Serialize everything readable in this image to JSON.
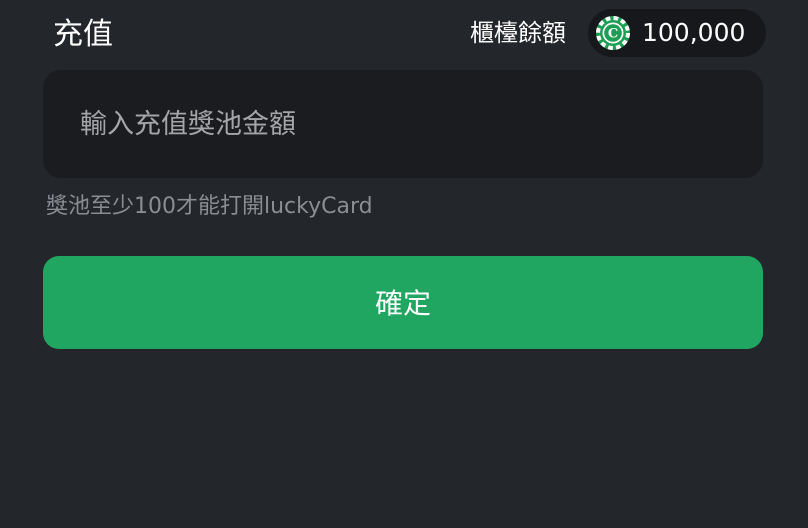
{
  "header": {
    "title": "充值",
    "balance_label": "櫃檯餘額",
    "balance_value": "100,000",
    "coin_icon": "chip-c-icon",
    "coin_letter": "C",
    "coin_color": "#1e9e55"
  },
  "form": {
    "amount_placeholder": "輸入充值獎池金額",
    "amount_value": "",
    "hint": "獎池至少100才能打開luckyCard",
    "confirm_label": "確定"
  },
  "colors": {
    "background": "#23262b",
    "input_background": "#1b1c1f",
    "pill_background": "#16181b",
    "accent": "#21a662",
    "hint_text": "#8a8d92"
  }
}
